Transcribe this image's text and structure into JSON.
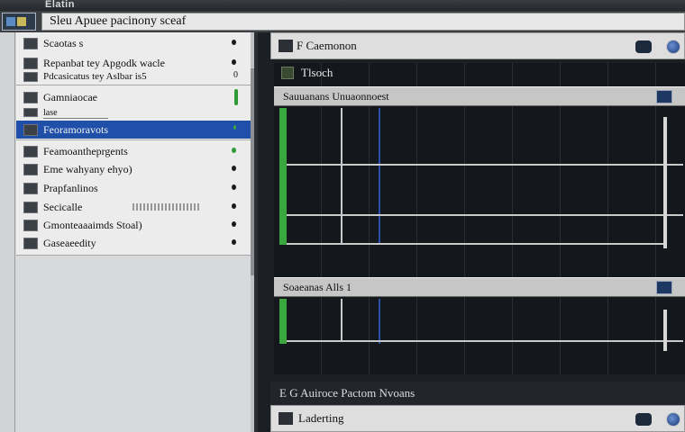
{
  "window": {
    "title": "Elatin"
  },
  "address": {
    "value": "Sleu Apuee pacinony sceaf"
  },
  "sidebar": {
    "items": [
      {
        "label": "Scaotas s",
        "icon": "folder-icon"
      },
      {
        "label": "Repanbat tey Apgodk wacle",
        "icon": "document-icon"
      },
      {
        "label": "Pdcasicatus tey Aslbar is5",
        "icon": "document-icon"
      },
      {
        "label": "Gamniaocae",
        "icon": "game-icon"
      },
      {
        "label": "lase",
        "icon": "image-icon"
      },
      {
        "label": "Feoramoravots",
        "icon": "tool-icon"
      },
      {
        "label": "Feamoantheprgents",
        "icon": "media-icon"
      },
      {
        "label": "Eme wahyany ehyo)",
        "icon": "list-icon"
      },
      {
        "label": "Prapfanlinos",
        "icon": "profile-icon"
      },
      {
        "label": "Secicalle",
        "icon": "settings-icon"
      },
      {
        "label": "Gmonteaaaimds Stoal)",
        "icon": "storage-icon"
      },
      {
        "label": "Gaseaeedity",
        "icon": "security-icon"
      }
    ],
    "second_item_count": "0"
  },
  "panel": {
    "header_title": "F Caemonon",
    "thumb_label": "Tlsoch",
    "section_top": "Sauuanans Unuaonnoest",
    "section_mid": "Soaeanas Alls 1",
    "footer_text": "E G Auiroce Pactom Nvoans",
    "bottom_title": "Laderting"
  },
  "colors": {
    "selection": "#1f4fa8",
    "accent_green": "#3aa63e",
    "track_bg": "#14171b"
  }
}
